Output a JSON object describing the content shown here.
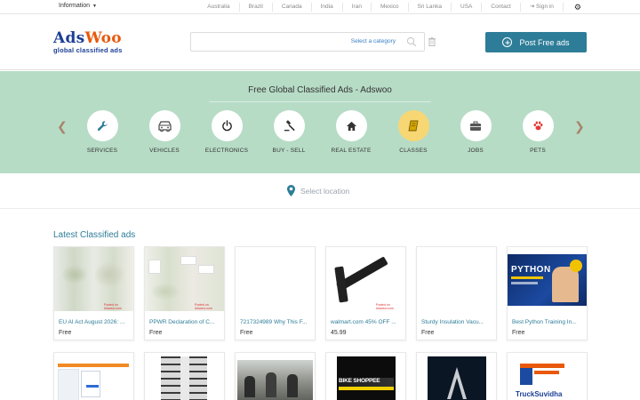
{
  "topbar": {
    "information_label": "Information",
    "links": [
      "Australia",
      "Brazil",
      "Canada",
      "India",
      "Iran",
      "Mexico",
      "Sri Lanka",
      "USA",
      "Contact",
      "Sign in"
    ]
  },
  "header": {
    "logo_part1": "Ads",
    "logo_part2": "Woo",
    "logo_tagline": "global classified ads",
    "search_placeholder": "",
    "category_label": "Select a category",
    "post_button_label": "Post Free ads",
    "accent_color": "#2e7d98"
  },
  "hero": {
    "title": "Free Global Classified Ads - Adswoo",
    "categories": [
      {
        "label": "SERVICES",
        "icon": "wrench-icon"
      },
      {
        "label": "VEHICLES",
        "icon": "car-icon"
      },
      {
        "label": "ELECTRONICS",
        "icon": "power-icon"
      },
      {
        "label": "BUY - SELL",
        "icon": "gavel-icon"
      },
      {
        "label": "REAL ESTATE",
        "icon": "home-icon"
      },
      {
        "label": "CLASSES",
        "icon": "book-icon"
      },
      {
        "label": "JOBS",
        "icon": "briefcase-icon"
      },
      {
        "label": "PETS",
        "icon": "paw-icon"
      }
    ],
    "background_color": "#b7dcc6"
  },
  "location": {
    "label": "Select location"
  },
  "latest": {
    "title": "Latest Classified ads",
    "cards": [
      {
        "title": "EU AI Act August 2026: ...",
        "price": "Free",
        "thumb_caption": "Posted on Adswoo.com"
      },
      {
        "title": "PPWR Declaration of C...",
        "price": "Free",
        "thumb_caption": "Posted on Adswoo.com"
      },
      {
        "title": "7217324989 Why This F...",
        "price": "Free",
        "thumb_caption": ""
      },
      {
        "title": "walmart.com 45% OFF ...",
        "price": "45.99",
        "thumb_caption": "Posted on Adswoo.com"
      },
      {
        "title": "Sturdy Insulation Vacu...",
        "price": "Free",
        "thumb_caption": ""
      },
      {
        "title": "Best Python Training In...",
        "price": "Free",
        "thumb_caption": "PYTHON"
      },
      {
        "title": "",
        "price": "",
        "thumb_caption": ""
      },
      {
        "title": "",
        "price": "",
        "thumb_caption": ""
      },
      {
        "title": "",
        "price": "",
        "thumb_caption": ""
      },
      {
        "title": "",
        "price": "",
        "thumb_caption": "BIKE SHOPPEE"
      },
      {
        "title": "",
        "price": "",
        "thumb_caption": ""
      },
      {
        "title": "",
        "price": "",
        "thumb_caption": "TruckSuvidha"
      }
    ]
  }
}
